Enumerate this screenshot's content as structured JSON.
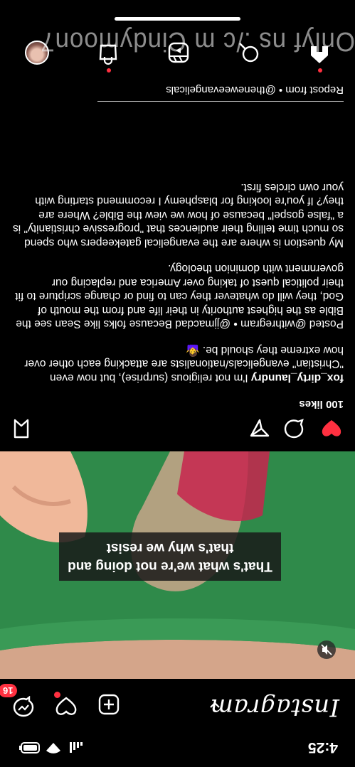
{
  "status": {
    "time": "4:25"
  },
  "header": {
    "app_title": "Instagram",
    "notification_count": "16"
  },
  "media": {
    "caption": "That's what we're not doing and that's why we resist"
  },
  "post": {
    "likes": "100 likes",
    "username": "fox_dirty_laundry",
    "paragraph1": "I'm not religious (surprise), but now even \"Christian\" evangelicals/nationalists are attacking each other over how extreme they should be. 🤷‍♀️",
    "paragraph2": "Posted @withregram • @jjmacdad Because folks like Sean see the Bible as the highest authority in their life and from the mouth of God, they will do whatever they can to find or change scripture to fit their political quest of taking over America and replacing our government with dominion theology.",
    "paragraph3": "My question is where are the evangelical gatekeepers who spend so much time telling their audiences that \"progressive christianity\" is a \"false gospel\" because of how we view the Bible? Where are they? If you're looking for blasphemy I recommend starting with your own circles first.",
    "repost": "Repost from • @theneweevangelicals"
  },
  "watermark": "Onlyf ns ./c m Cindymoon7",
  "colors": {
    "like_red": "#ff3040",
    "shirt_green": "#2f8a4a",
    "background": "#000000"
  },
  "icons": [
    "heart-icon",
    "comment-icon",
    "share-icon",
    "bookmark-icon",
    "plus-icon",
    "messenger-icon",
    "home-icon",
    "search-icon",
    "reels-icon",
    "shop-icon",
    "avatar",
    "mute-icon"
  ]
}
